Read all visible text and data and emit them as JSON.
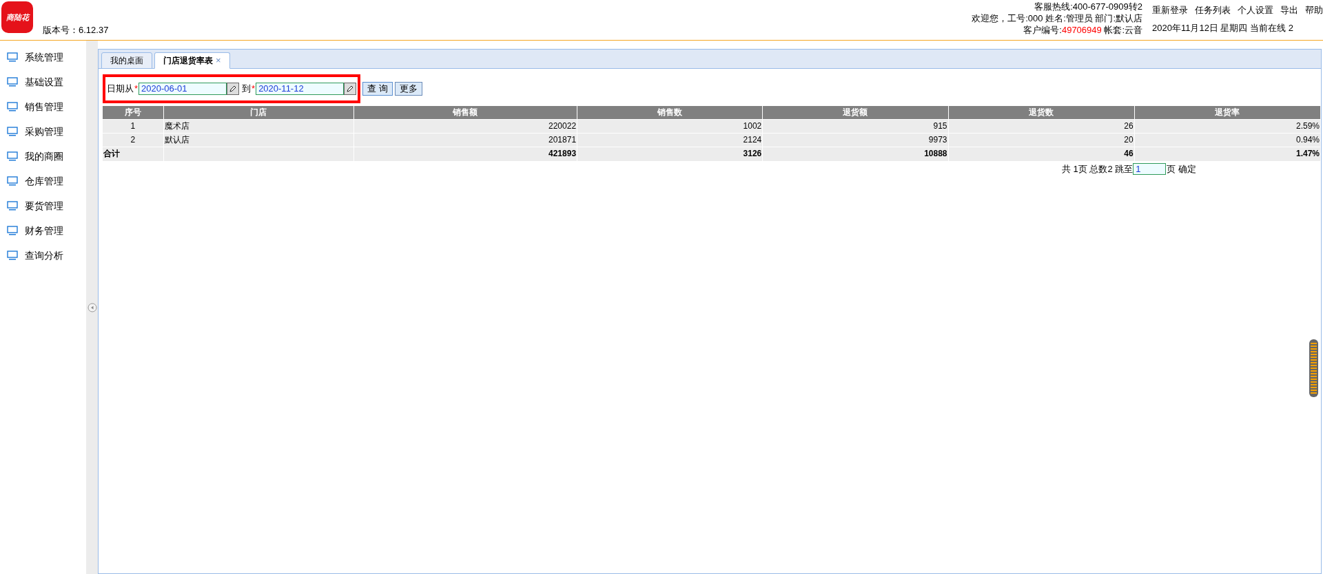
{
  "header": {
    "logo_text": "商陆花",
    "version": "版本号：6.12.37",
    "hotline": "客服热线:400-677-0909转2",
    "welcome": "欢迎您，工号:000 姓名:管理员 部门:默认店",
    "customer_label": "客户编号:",
    "customer_no": "49706949",
    "account": "帐套:云音",
    "links": [
      "重新登录",
      "任务列表",
      "个人设置",
      "导出",
      "帮助"
    ],
    "date_line": "2020年11月12日 星期四 当前在线 2"
  },
  "sidebar": {
    "items": [
      {
        "label": "系统管理"
      },
      {
        "label": "基础设置"
      },
      {
        "label": "销售管理"
      },
      {
        "label": "采购管理"
      },
      {
        "label": "我的商圈"
      },
      {
        "label": "仓库管理"
      },
      {
        "label": "要货管理"
      },
      {
        "label": "财务管理"
      },
      {
        "label": "查询分析"
      }
    ]
  },
  "tabs": [
    {
      "label": "我的桌面",
      "selected": false
    },
    {
      "label": "门店退货率表",
      "selected": true,
      "close": "×"
    }
  ],
  "filter": {
    "from_label": "日期从",
    "required_mark": "*",
    "from": "2020-06-01",
    "to_label": "到",
    "to": "2020-11-12",
    "buttons": [
      "查 询",
      "更多"
    ]
  },
  "table": {
    "columns": [
      "序号",
      "门店",
      "销售额",
      "销售数",
      "退货额",
      "退货数",
      "退货率"
    ],
    "rows": [
      [
        "1",
        "魔术店",
        "220022",
        "1002",
        "915",
        "26",
        "2.59%"
      ],
      [
        "2",
        "默认店",
        "201871",
        "2124",
        "9973",
        "20",
        "0.94%"
      ]
    ],
    "total": {
      "label": "合计",
      "values": [
        "421893",
        "3126",
        "10888",
        "46",
        "1.47%"
      ]
    }
  },
  "pager": {
    "summary": "共 1页 总数2 跳至",
    "page": "1",
    "suffix": "页",
    "confirm": "确定"
  }
}
